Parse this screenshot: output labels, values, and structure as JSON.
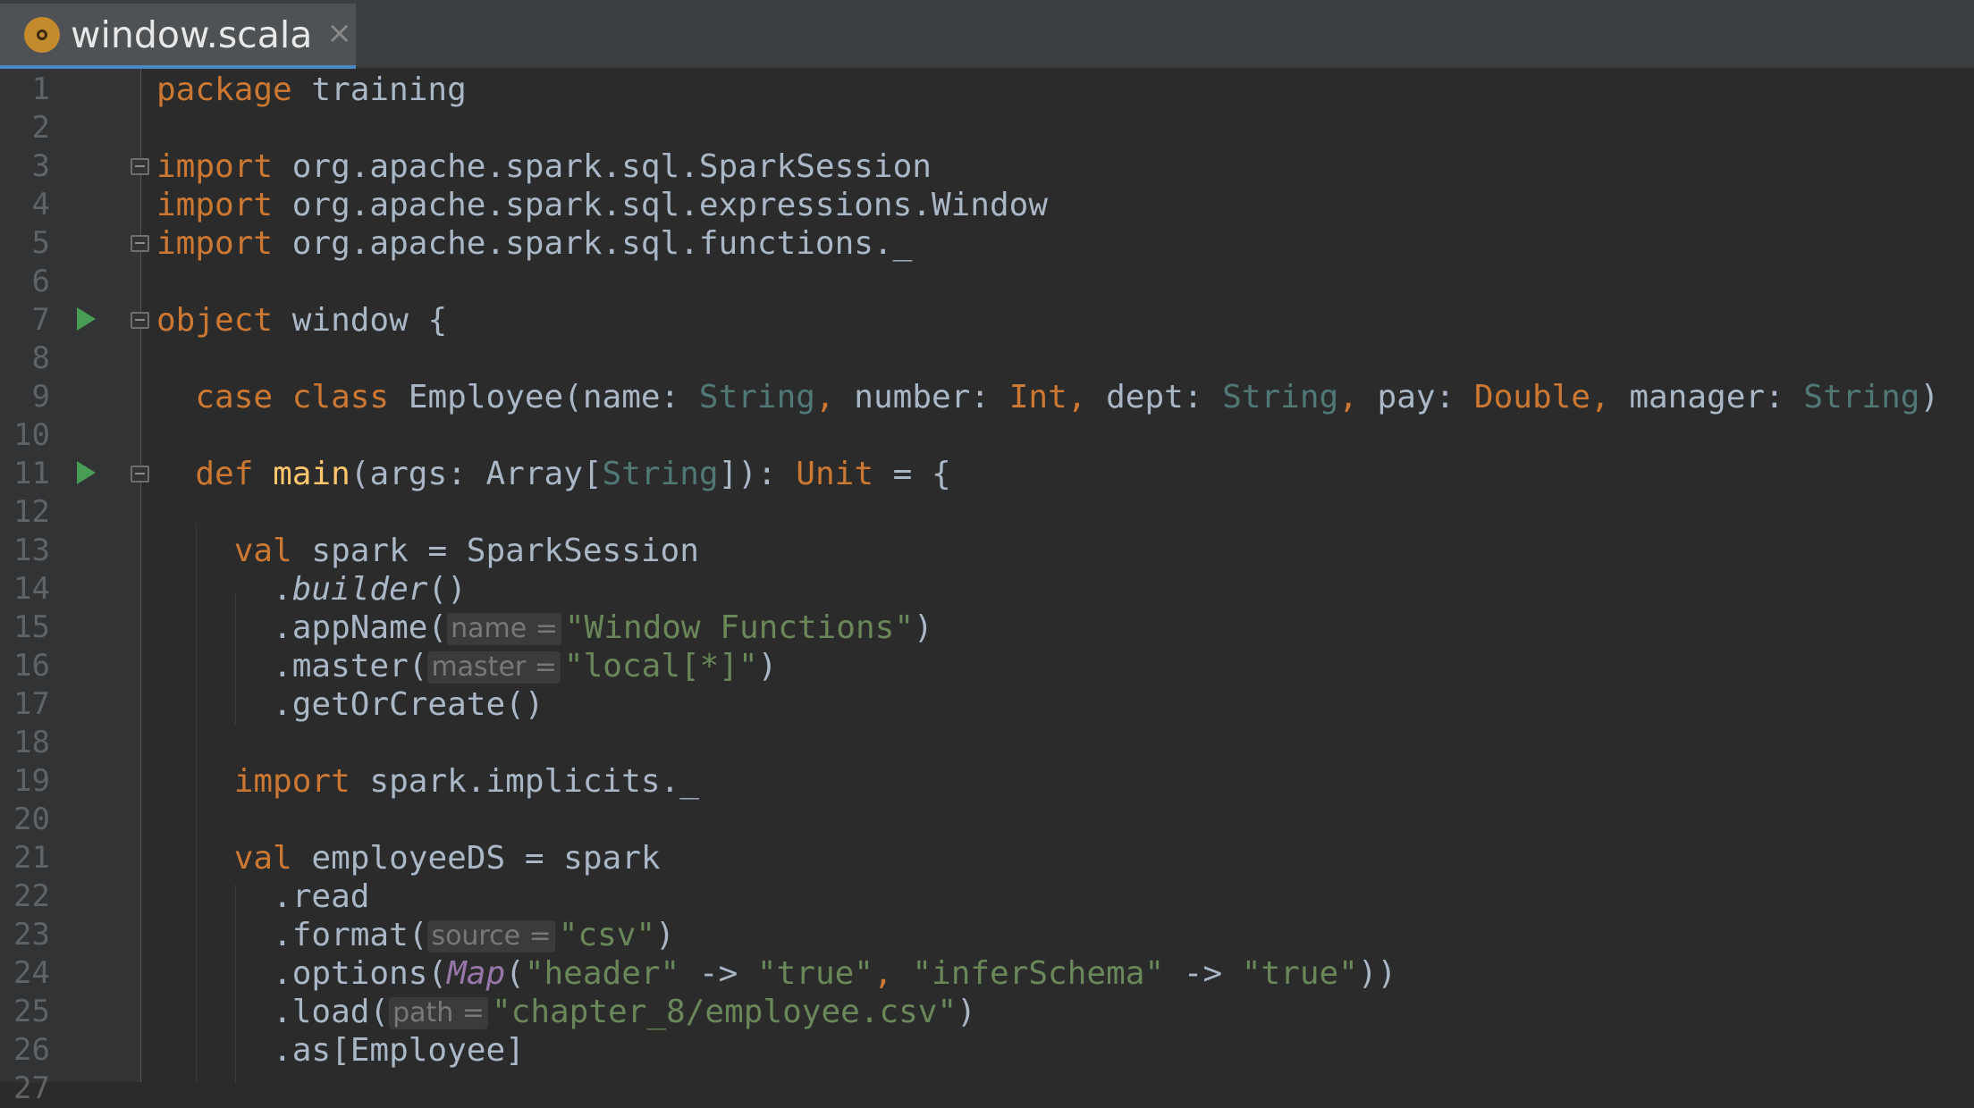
{
  "tab": {
    "filename": "window.scala",
    "close": "×",
    "icon": "scala-object-icon"
  },
  "gutter_markers": {
    "run_lines": [
      7,
      11
    ],
    "fold_lines": [
      3,
      5,
      7,
      11
    ]
  },
  "colors": {
    "background": "#2b2b2b",
    "keyword": "#cc7832",
    "string": "#6a8759",
    "type_param": "#507874",
    "function_name": "#ffc66d",
    "plain": "#a9b7c6"
  },
  "lines": [
    {
      "num": "1",
      "tokens": [
        [
          "package",
          "k"
        ],
        [
          " training",
          ""
        ]
      ]
    },
    {
      "num": "2",
      "tokens": []
    },
    {
      "num": "3",
      "tokens": [
        [
          "import",
          "k"
        ],
        [
          " org.apache.spark.sql.SparkSession",
          ""
        ]
      ]
    },
    {
      "num": "4",
      "tokens": [
        [
          "import",
          "k"
        ],
        [
          " org.apache.spark.sql.expressions.Window",
          ""
        ]
      ]
    },
    {
      "num": "5",
      "tokens": [
        [
          "import",
          "k"
        ],
        [
          " org.apache.spark.sql.functions._",
          ""
        ]
      ]
    },
    {
      "num": "6",
      "tokens": []
    },
    {
      "num": "7",
      "tokens": [
        [
          "object",
          "k"
        ],
        [
          " window {",
          ""
        ]
      ]
    },
    {
      "num": "8",
      "tokens": []
    },
    {
      "num": "9",
      "tokens": [
        [
          "  ",
          ""
        ],
        [
          "case class",
          "k"
        ],
        [
          " Employee(name: ",
          ""
        ],
        [
          "String",
          "tt"
        ],
        [
          ",",
          "k"
        ],
        [
          " number: ",
          ""
        ],
        [
          "Int",
          "k"
        ],
        [
          ",",
          "k"
        ],
        [
          " dept: ",
          ""
        ],
        [
          "String",
          "tt"
        ],
        [
          ",",
          "k"
        ],
        [
          " pay: ",
          ""
        ],
        [
          "Double",
          "k"
        ],
        [
          ",",
          "k"
        ],
        [
          " manager: ",
          ""
        ],
        [
          "String",
          "tt"
        ],
        [
          ")",
          ""
        ]
      ]
    },
    {
      "num": "10",
      "tokens": []
    },
    {
      "num": "11",
      "tokens": [
        [
          "  ",
          ""
        ],
        [
          "def",
          "k"
        ],
        [
          " ",
          ""
        ],
        [
          "main",
          "fn"
        ],
        [
          "(args: Array[",
          ""
        ],
        [
          "String",
          "tt"
        ],
        [
          "]): ",
          ""
        ],
        [
          "Unit",
          "k"
        ],
        [
          " = {",
          ""
        ]
      ]
    },
    {
      "num": "12",
      "tokens": []
    },
    {
      "num": "13",
      "tokens": [
        [
          "    ",
          ""
        ],
        [
          "val",
          "k"
        ],
        [
          " spark = SparkSession",
          ""
        ]
      ]
    },
    {
      "num": "14",
      "tokens": [
        [
          "      .",
          ""
        ],
        [
          "builder",
          "it"
        ],
        [
          "()",
          ""
        ]
      ]
    },
    {
      "num": "15",
      "tokens": [
        [
          "      .appName(",
          ""
        ],
        [
          "name =",
          "hint"
        ],
        [
          "\"Window Functions\"",
          "s"
        ],
        [
          ")",
          ""
        ]
      ]
    },
    {
      "num": "16",
      "tokens": [
        [
          "      .master(",
          ""
        ],
        [
          "master =",
          "hint"
        ],
        [
          "\"local[*]\"",
          "s"
        ],
        [
          ")",
          ""
        ]
      ]
    },
    {
      "num": "17",
      "tokens": [
        [
          "      .getOrCreate()",
          ""
        ]
      ]
    },
    {
      "num": "18",
      "tokens": []
    },
    {
      "num": "19",
      "tokens": [
        [
          "    ",
          ""
        ],
        [
          "import",
          "k"
        ],
        [
          " spark.implicits._",
          ""
        ]
      ]
    },
    {
      "num": "20",
      "tokens": []
    },
    {
      "num": "21",
      "tokens": [
        [
          "    ",
          ""
        ],
        [
          "val",
          "k"
        ],
        [
          " employeeDS = spark",
          ""
        ]
      ]
    },
    {
      "num": "22",
      "tokens": [
        [
          "      .read",
          ""
        ]
      ]
    },
    {
      "num": "23",
      "tokens": [
        [
          "      .format(",
          ""
        ],
        [
          "source =",
          "hint"
        ],
        [
          "\"csv\"",
          "s"
        ],
        [
          ")",
          ""
        ]
      ]
    },
    {
      "num": "24",
      "tokens": [
        [
          "      .options(",
          ""
        ],
        [
          "Map",
          "mp"
        ],
        [
          "(",
          ""
        ],
        [
          "\"header\"",
          "s"
        ],
        [
          " -> ",
          ""
        ],
        [
          "\"true\"",
          "s"
        ],
        [
          ",",
          "k"
        ],
        [
          " ",
          ""
        ],
        [
          "\"inferSchema\"",
          "s"
        ],
        [
          " -> ",
          ""
        ],
        [
          "\"true\"",
          "s"
        ],
        [
          "))",
          ""
        ]
      ]
    },
    {
      "num": "25",
      "tokens": [
        [
          "      .load(",
          ""
        ],
        [
          "path =",
          "hint"
        ],
        [
          "\"chapter_8/employee.csv\"",
          "s"
        ],
        [
          ")",
          ""
        ]
      ]
    },
    {
      "num": "26",
      "tokens": [
        [
          "      .as[Employee]",
          ""
        ]
      ]
    },
    {
      "num": "27",
      "tokens": []
    }
  ]
}
